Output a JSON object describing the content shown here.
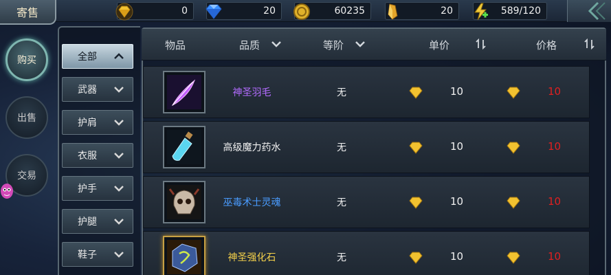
{
  "title": "寄售",
  "resources": [
    {
      "icon": "gold-diamond-icon",
      "value": "0"
    },
    {
      "icon": "blue-diamond-icon",
      "value": "20"
    },
    {
      "icon": "gold-coin-icon",
      "value": "60235"
    },
    {
      "icon": "gold-crystal-icon",
      "value": "20"
    },
    {
      "icon": "energy-icon",
      "value": "589/120"
    }
  ],
  "modes": [
    {
      "label": "购买",
      "active": true
    },
    {
      "label": "出售",
      "active": false
    },
    {
      "label": "交易",
      "active": false
    }
  ],
  "categories": [
    {
      "label": "全部",
      "active": true
    },
    {
      "label": "武器",
      "active": false
    },
    {
      "label": "护肩",
      "active": false
    },
    {
      "label": "衣服",
      "active": false
    },
    {
      "label": "护手",
      "active": false
    },
    {
      "label": "护腿",
      "active": false
    },
    {
      "label": "鞋子",
      "active": false
    }
  ],
  "columns": {
    "item": "物品",
    "quality": "品质",
    "level": "等阶",
    "unit_price": "单价",
    "price": "价格"
  },
  "rows": [
    {
      "name": "神圣羽毛",
      "name_color": "#b36cff",
      "grade": "无",
      "unit_price": "10",
      "price": "10",
      "icon": "feather-icon"
    },
    {
      "name": "高级魔力药水",
      "name_color": "#f0f0f0",
      "grade": "无",
      "unit_price": "10",
      "price": "10",
      "icon": "potion-icon"
    },
    {
      "name": "巫毒术士灵魂",
      "name_color": "#4a9cff",
      "grade": "无",
      "unit_price": "10",
      "price": "10",
      "icon": "skull-icon"
    },
    {
      "name": "神圣强化石",
      "name_color": "#f5d14a",
      "grade": "无",
      "unit_price": "10",
      "price": "10",
      "icon": "rune-stone-icon"
    }
  ],
  "colors": {
    "price_red": "#e02020",
    "gold": "#f2c230",
    "accent": "#7fb6b0"
  }
}
